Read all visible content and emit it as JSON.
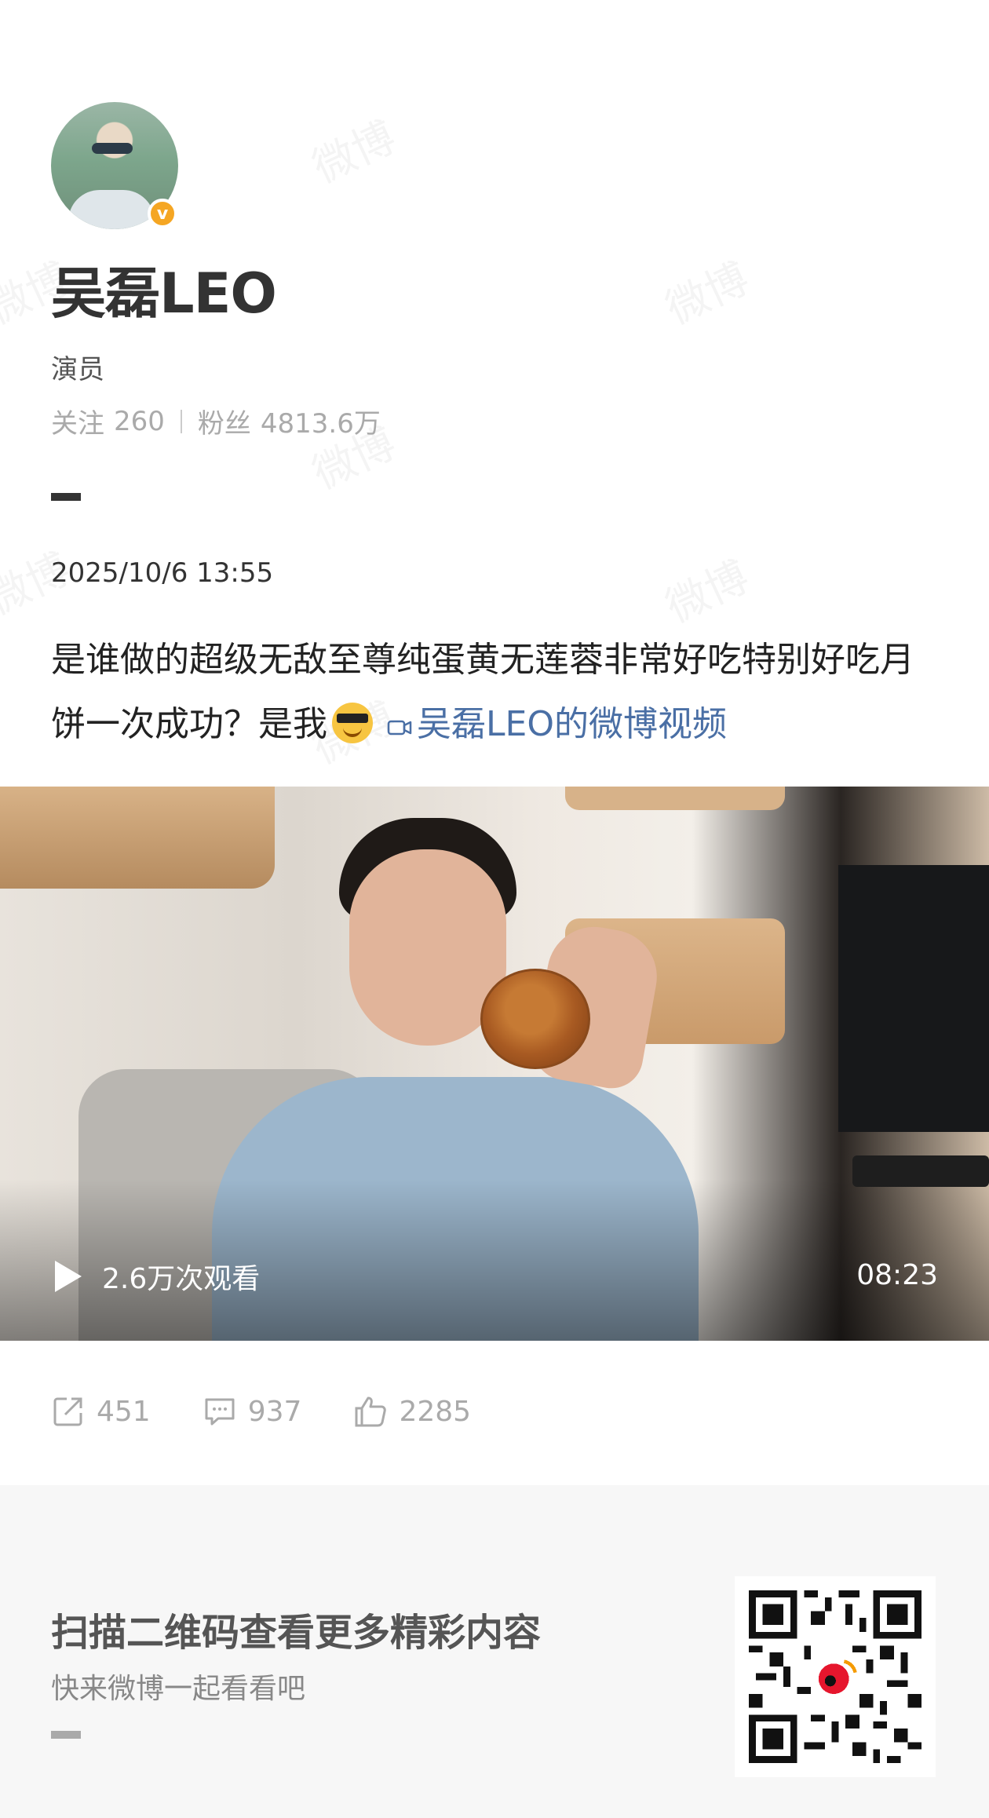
{
  "profile": {
    "name": "吴磊LEO",
    "role": "演员",
    "following_label": "关注",
    "following_count": "260",
    "followers_label": "粉丝",
    "followers_count": "4813.6万",
    "verified_badge": "v"
  },
  "post": {
    "date": "2025/10/6 13:55",
    "text": "是谁做的超级无敌至尊纯蛋黄无莲蓉非常好吃特别好吃月饼一次成功？是我",
    "emoji": "sunglasses-face-icon",
    "video_link": "吴磊LEO的微博视频"
  },
  "video": {
    "views": "2.6万次观看",
    "duration": "08:23"
  },
  "actions": {
    "reposts": "451",
    "comments": "937",
    "likes": "2285"
  },
  "footer": {
    "title": "扫描二维码查看更多精彩内容",
    "subtitle": "快来微博一起看看吧"
  },
  "watermark": "微博",
  "colors": {
    "link": "#4a6fa5",
    "verified": "#f5a623",
    "footer_bg": "#f7f7f7"
  }
}
